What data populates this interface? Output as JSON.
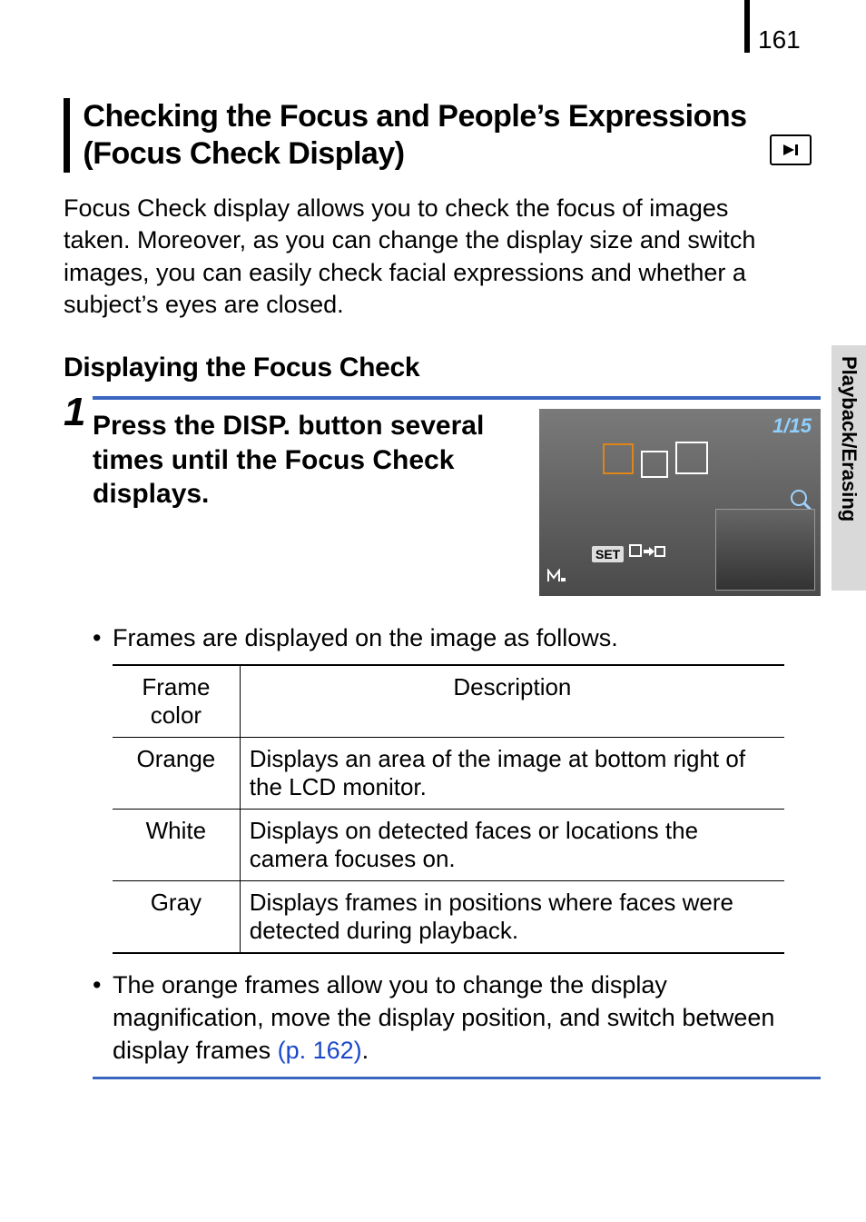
{
  "page_number": "161",
  "heading": "Checking the Focus and People’s Expressions (Focus Check Display)",
  "intro": "Focus Check display allows you to check the focus of images taken. Moreover, as you can change the display size and switch images, you can easily check facial expressions and whether a subject’s eyes are closed.",
  "subheading": "Displaying the Focus Check",
  "step": {
    "number": "1",
    "text_before": "Press the ",
    "disp": "DISP.",
    "text_after": " button several times until the Focus Check displays."
  },
  "screenshot": {
    "counter": "1/15",
    "set_label": "SET"
  },
  "bullet1": "Frames are displayed on the image as follows.",
  "table": {
    "headers": {
      "col1": "Frame color",
      "col2": "Description"
    },
    "rows": [
      {
        "color": "Orange",
        "desc": "Displays an area of the image at bottom right of the LCD monitor."
      },
      {
        "color": "White",
        "desc": "Displays on detected faces or locations the camera focuses on."
      },
      {
        "color": "Gray",
        "desc": "Displays frames in positions where faces were detected during playback."
      }
    ]
  },
  "bullet2_before": "The orange frames allow you to change the display magnification, move the display position, and switch between display frames ",
  "page_ref": "(p. 162)",
  "bullet2_after": ".",
  "side_tab": "Playback/Erasing"
}
